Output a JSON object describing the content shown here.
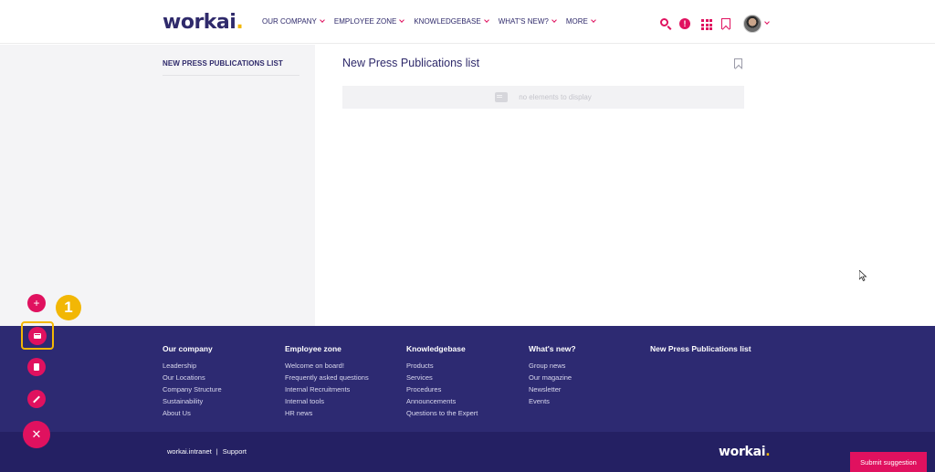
{
  "header": {
    "logo_text": "workai",
    "logo_dot": ".",
    "nav": [
      {
        "label": "OUR COMPANY"
      },
      {
        "label": "EMPLOYEE ZONE"
      },
      {
        "label": "KNOWLEDGEBASE"
      },
      {
        "label": "WHAT'S NEW?"
      },
      {
        "label": "MORE"
      }
    ],
    "alert_glyph": "!",
    "icons": [
      "search-icon",
      "alert-icon",
      "apps-grid-icon",
      "bookmark-icon",
      "avatar"
    ]
  },
  "sidebar": {
    "link_label": "NEW PRESS PUBLICATIONS LIST"
  },
  "main": {
    "title": "New Press Publications list",
    "empty_text": "no elements to display"
  },
  "footer": {
    "columns": [
      {
        "heading": "Our company",
        "links": [
          "Leadership",
          "Our Locations",
          "Company Structure",
          "Sustainability",
          "About Us"
        ]
      },
      {
        "heading": "Employee zone",
        "links": [
          "Welcome on board!",
          "Frequently asked questions",
          "Internal Recruitments",
          "Internal tools",
          "HR news"
        ]
      },
      {
        "heading": "Knowledgebase",
        "links": [
          "Products",
          "Services",
          "Procedures",
          "Announcements",
          "Questions to the Expert"
        ]
      },
      {
        "heading": "What's new?",
        "links": [
          "Group news",
          "Our magazine",
          "Newsletter",
          "Events"
        ]
      },
      {
        "heading": "New Press Publications list",
        "links": []
      }
    ],
    "bottom_links": [
      "workai.intranet",
      "Support"
    ],
    "bottom_separator": "|",
    "bottom_logo_text": "workai",
    "bottom_logo_dot": "."
  },
  "submit_button_label": "Submit suggestion",
  "fab": {
    "plus_glyph": "+",
    "close_glyph": "✕",
    "step_badge": "1"
  },
  "colors": {
    "accent": "#e0115f",
    "brand_navy": "#2d2a72",
    "highlight": "#f2b705"
  }
}
